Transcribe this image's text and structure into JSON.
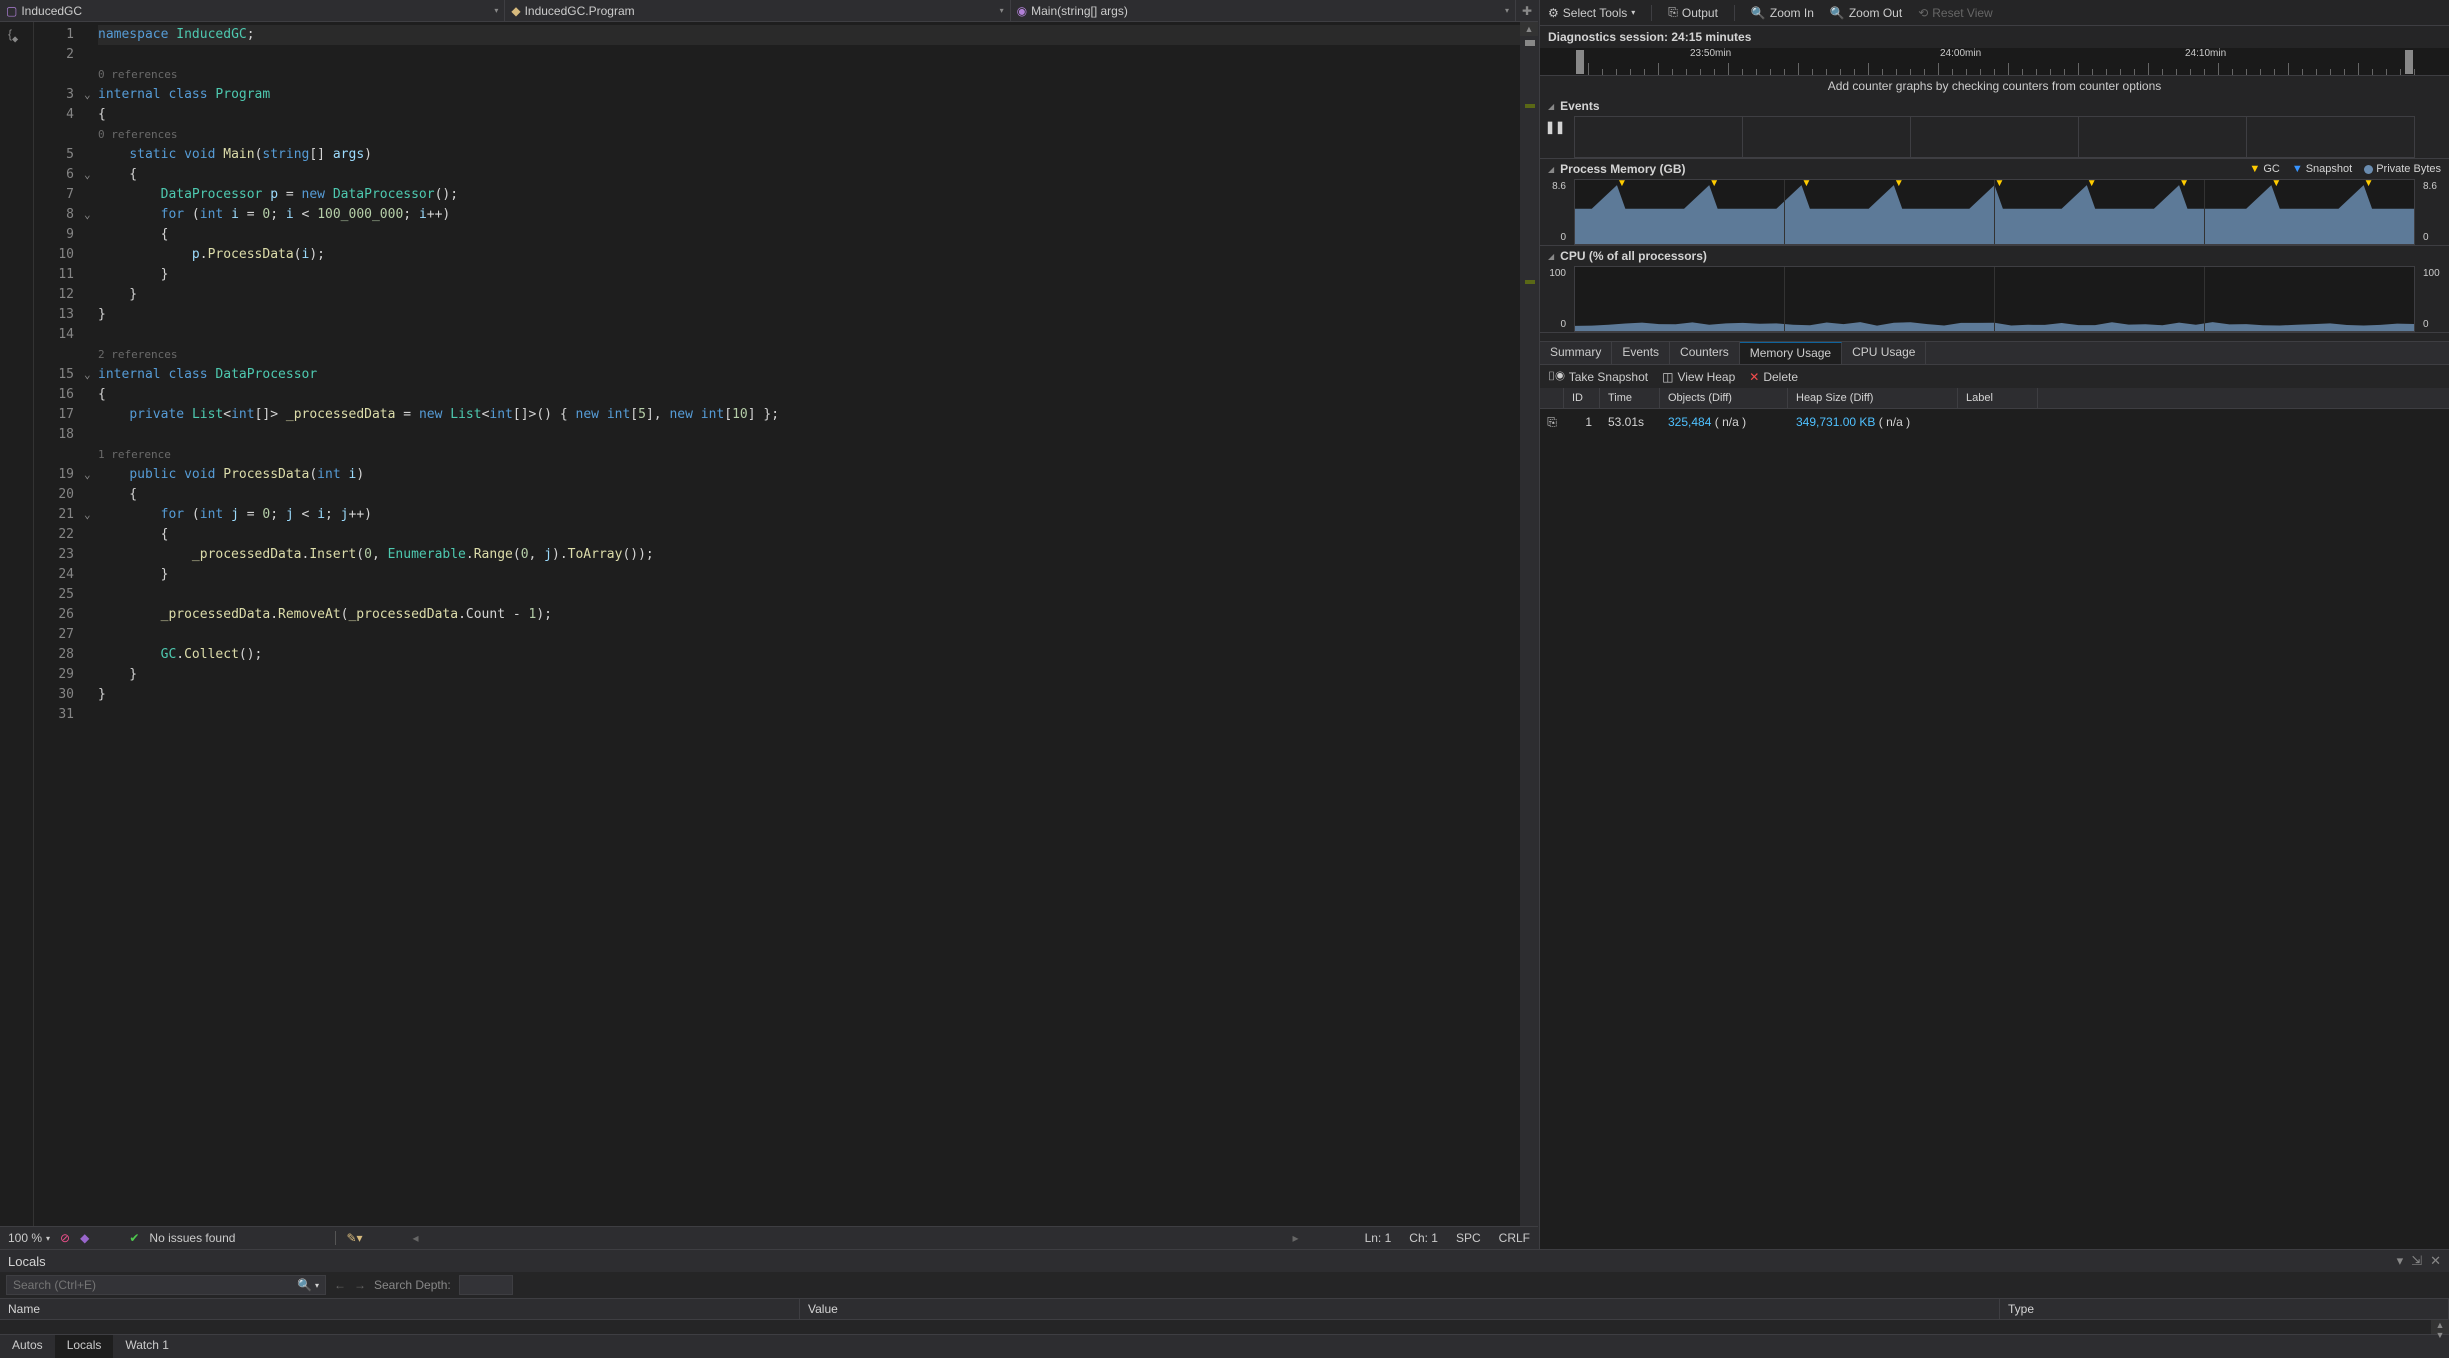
{
  "nav": {
    "item1": "InducedGC",
    "item2": "InducedGC.Program",
    "item3": "Main(string[] args)"
  },
  "code": {
    "ref0": "0 references",
    "ref1": "1 reference",
    "ref2": "2 references",
    "lines": 31
  },
  "status": {
    "zoom": "100 %",
    "issues": "No issues found",
    "ln": "Ln: 1",
    "ch": "Ch: 1",
    "spc": "SPC",
    "crlf": "CRLF"
  },
  "diag": {
    "select_tools": "Select Tools",
    "output": "Output",
    "zoom_in": "Zoom In",
    "zoom_out": "Zoom Out",
    "reset_view": "Reset View",
    "session": "Diagnostics session: 24:15 minutes",
    "timeline": {
      "t1": "23:50min",
      "t2": "24:00min",
      "t3": "24:10min"
    },
    "hint": "Add counter graphs by checking counters from counter options",
    "events_title": "Events",
    "memory_title": "Process Memory (GB)",
    "memory_legend": {
      "gc": "GC",
      "snapshot": "Snapshot",
      "private": "Private Bytes"
    },
    "memory_yaxis": {
      "top": "8.6",
      "bottom": "0"
    },
    "cpu_title": "CPU (% of all processors)",
    "cpu_yaxis": {
      "top": "100",
      "bottom": "0"
    },
    "tabs": {
      "summary": "Summary",
      "events": "Events",
      "counters": "Counters",
      "memory": "Memory Usage",
      "cpu": "CPU Usage"
    },
    "actions": {
      "snapshot": "Take Snapshot",
      "heap": "View Heap",
      "delete": "Delete"
    },
    "snap_cols": {
      "id": "ID",
      "time": "Time",
      "objects": "Objects (Diff)",
      "heap": "Heap Size (Diff)",
      "label": "Label"
    },
    "snap_row": {
      "id": "1",
      "time": "53.01s",
      "objects": "325,484",
      "objects_diff": "( n/a )",
      "heap": "349,731.00 KB",
      "heap_diff": "( n/a )"
    }
  },
  "locals": {
    "title": "Locals",
    "search_ph": "Search (Ctrl+E)",
    "depth_label": "Search Depth:",
    "cols": {
      "name": "Name",
      "value": "Value",
      "type": "Type"
    }
  },
  "bottom_tabs": {
    "autos": "Autos",
    "locals": "Locals",
    "watch": "Watch 1"
  },
  "chart_data": {
    "memory": {
      "type": "area",
      "ymax": 8.6,
      "ymin": 0,
      "peaks_x_pct": [
        5,
        16,
        27,
        38,
        50,
        61,
        72,
        83,
        94
      ],
      "baseline_pct": 55,
      "peak_pct": 92
    },
    "cpu": {
      "type": "area",
      "ymax": 100,
      "ymin": 0,
      "avg_pct": 8
    }
  }
}
